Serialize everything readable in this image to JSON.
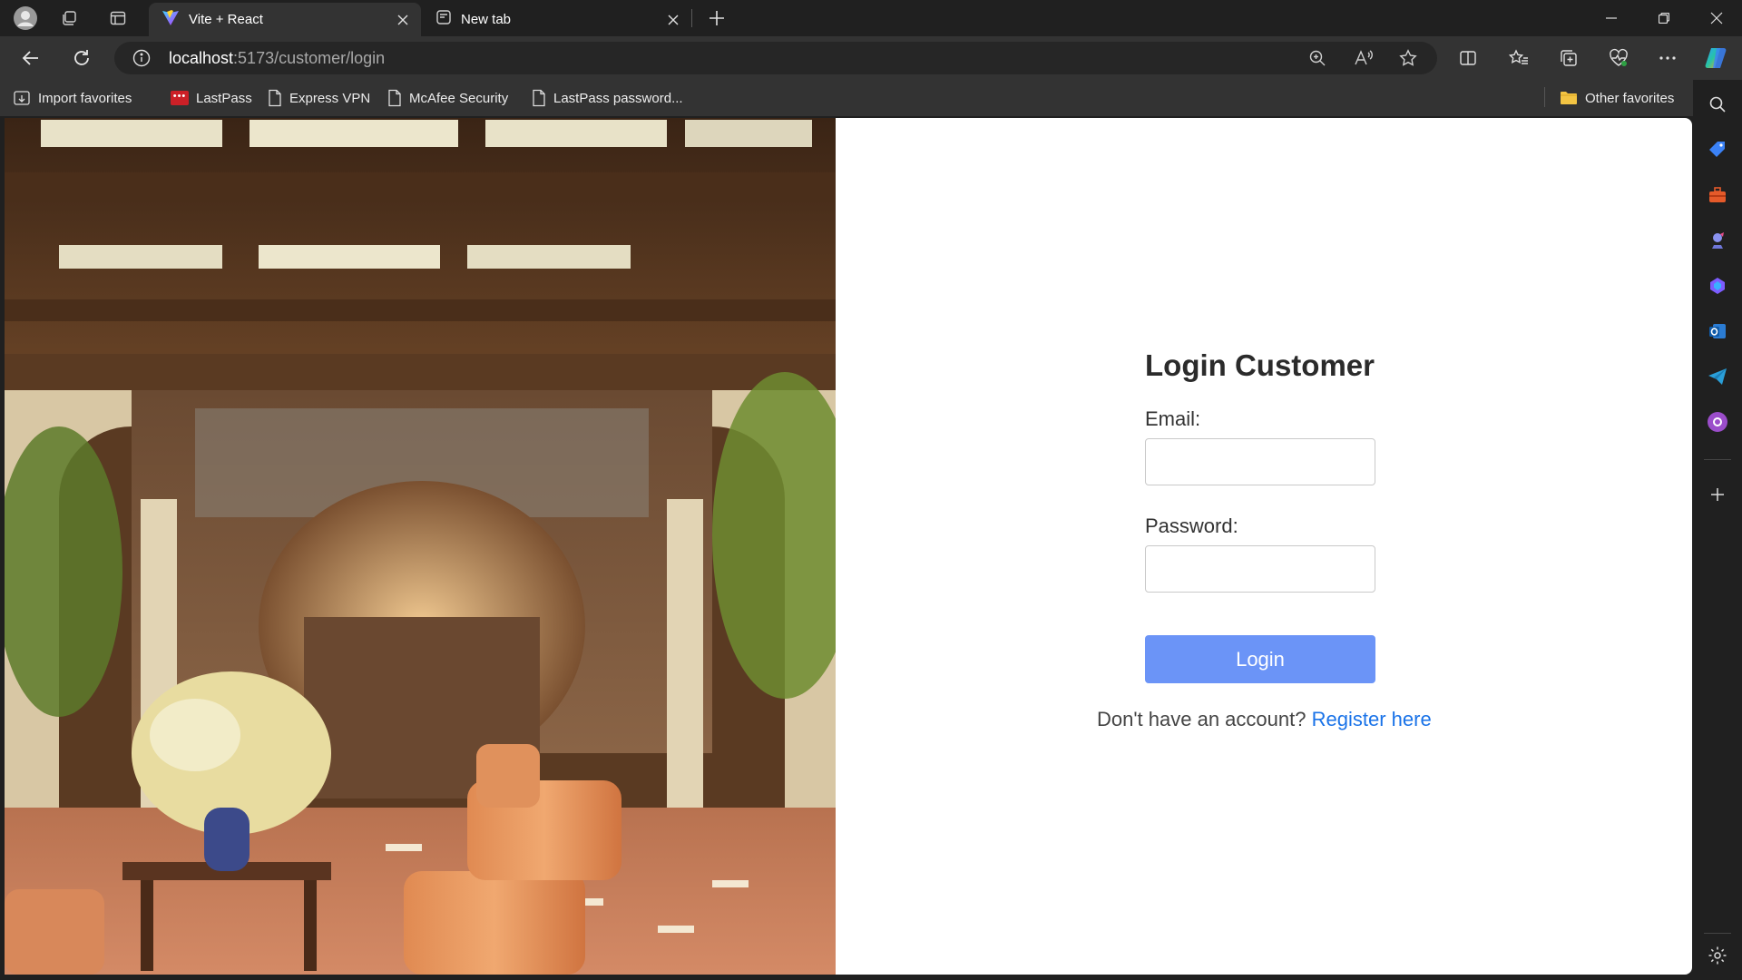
{
  "browser": {
    "tabs": [
      {
        "title": "Vite + React",
        "active": true,
        "icon": "vite-logo-icon"
      },
      {
        "title": "New tab",
        "active": false,
        "icon": "new-tab-page-icon"
      }
    ],
    "address": {
      "host": "localhost",
      "path": ":5173/customer/login"
    },
    "favorites": [
      {
        "label": "Import favorites",
        "icon": "import-icon"
      },
      {
        "label": "LastPass",
        "icon": "lastpass-icon",
        "badge": "•••"
      },
      {
        "label": "Express VPN",
        "icon": "page-icon"
      },
      {
        "label": "McAfee Security",
        "icon": "page-icon"
      },
      {
        "label": "LastPass password...",
        "icon": "page-icon"
      }
    ],
    "other_favorites": "Other favorites"
  },
  "page": {
    "title": "Login Customer",
    "email_label": "Email:",
    "email_value": "",
    "password_label": "Password:",
    "password_value": "",
    "login_button": "Login",
    "register_prompt": "Don't have an account?",
    "register_link": "Register here"
  },
  "colors": {
    "login_button": "#6b94f7",
    "link": "#1a73e8",
    "chrome_dark": "#202020",
    "chrome_toolbar": "#333333"
  }
}
